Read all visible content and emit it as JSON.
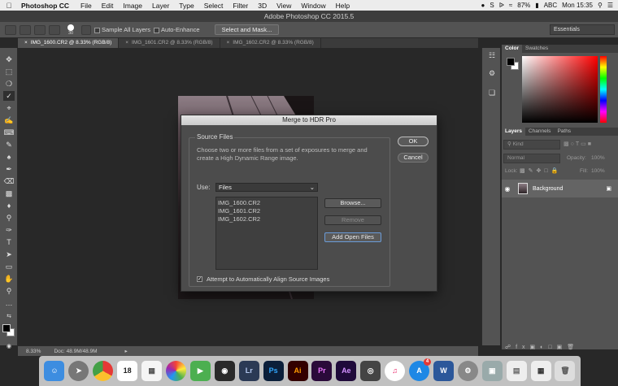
{
  "menubar": {
    "apple": "",
    "app_name": "Photoshop CC",
    "items": [
      "File",
      "Edit",
      "Image",
      "Layer",
      "Type",
      "Select",
      "Filter",
      "3D",
      "View",
      "Window",
      "Help"
    ],
    "battery": "87%",
    "input_source": "ABC",
    "clock": "Mon 15:35"
  },
  "window": {
    "title": "Adobe Photoshop CC 2015.5"
  },
  "options_bar": {
    "brush_size": "30",
    "sample_all_layers": "Sample All Layers",
    "auto_enhance": "Auto-Enhance",
    "select_mask": "Select and Mask...",
    "workspace": "Essentials"
  },
  "tabs": [
    {
      "label": "IMG_1600.CR2 @ 8.33% (RGB/8)",
      "close": "×"
    },
    {
      "label": "IMG_1601.CR2 @ 8.33% (RGB/8)",
      "close": "×"
    },
    {
      "label": "IMG_1602.CR2 @ 8.33% (RGB/8)",
      "close": "×"
    }
  ],
  "status": {
    "zoom": "8.33%",
    "doc": "Doc: 48.9M/48.9M"
  },
  "panels": {
    "color_tabs": [
      "Color",
      "Swatches"
    ],
    "layer_tabs": [
      "Layers",
      "Channels",
      "Paths"
    ],
    "kind_placeholder": "Kind",
    "blend_mode": "Normal",
    "opacity_label": "Opacity:",
    "opacity": "100%",
    "lock_label": "Lock:",
    "fill_label": "Fill:",
    "fill": "100%",
    "layer_name": "Background"
  },
  "dialog": {
    "title": "Merge to HDR Pro",
    "group_label": "Source Files",
    "description": "Choose two or more files from a set of exposures to merge and create a High Dynamic Range image.",
    "use_label": "Use:",
    "use_value": "Files",
    "files": [
      "IMG_1600.CR2",
      "IMG_1601.CR2",
      "IMG_1602.CR2"
    ],
    "browse": "Browse...",
    "remove": "Remove",
    "add_open": "Add Open Files",
    "align_label": "Attempt to Automatically Align Source Images",
    "ok": "OK",
    "cancel": "Cancel"
  },
  "dock": {
    "lr": "Lr",
    "ps": "Ps",
    "ai": "Ai",
    "pr": "Pr",
    "ae": "Ae",
    "calendar_day": "18",
    "appstore_badge": "4",
    "word": "W"
  },
  "colors": {
    "accent": "#6a9bd8",
    "photoshop_blue": "#31a8ff"
  }
}
